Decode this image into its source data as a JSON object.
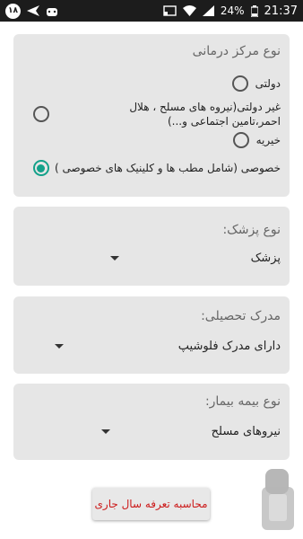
{
  "status_bar": {
    "badge": "۱۸",
    "battery": "24%",
    "time": "21:37"
  },
  "center_type": {
    "title": "نوع مرکز درمانی",
    "options": [
      {
        "label": "دولتی",
        "checked": false
      },
      {
        "label": "غیر دولتی(نیروه های مسلح ، هلال احمر،تامین اجتماعی و...)",
        "checked": false
      },
      {
        "label": "خیریه",
        "checked": false
      },
      {
        "label": "خصوصی (شامل مطب ها و کلینیک های خصوصی )",
        "checked": true
      }
    ]
  },
  "doctor_type": {
    "title": "نوع پزشک:",
    "selected": "پزشک"
  },
  "degree": {
    "title": "مدرک تحصیلی:",
    "selected": "دارای مدرک فلوشیپ"
  },
  "insurance": {
    "title": "نوع بیمه بیمار:",
    "selected": "نیروهای مسلح"
  },
  "calc_button": {
    "label": "محاسبه تعرفه سال جاری"
  },
  "colors": {
    "accent": "#13a18a",
    "button_text": "#cc1a1a",
    "card_bg": "#e6e6e6"
  }
}
